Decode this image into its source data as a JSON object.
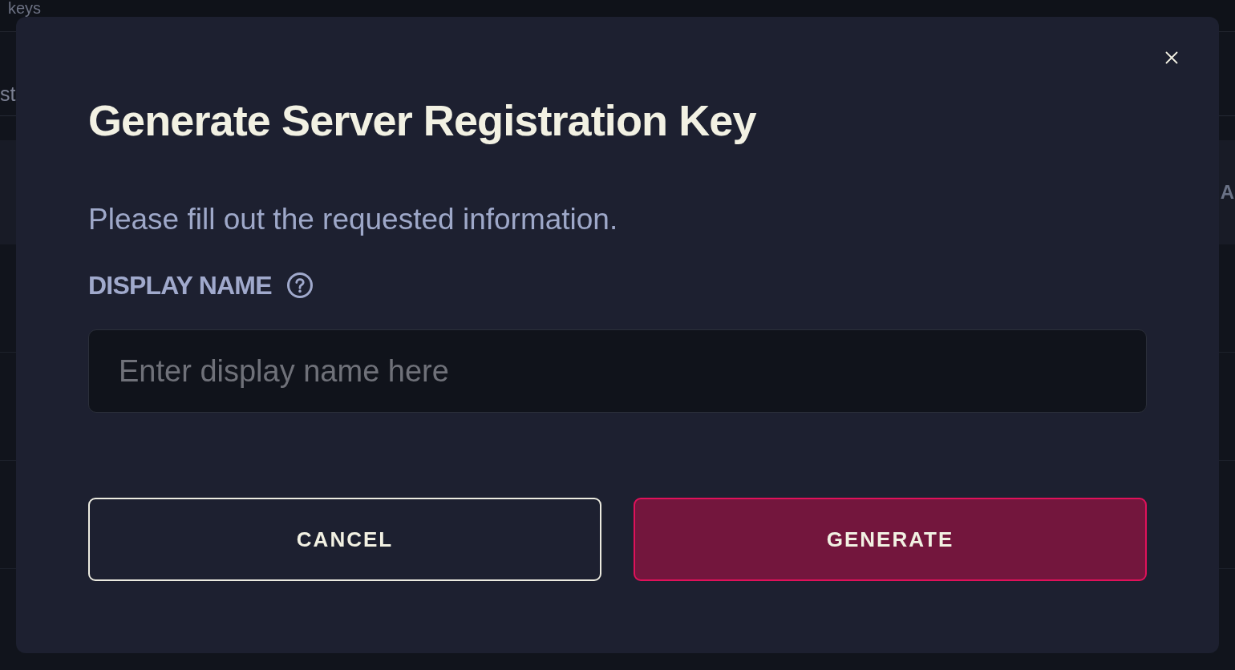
{
  "background_page": {
    "title_fragment": "keys",
    "left_fragment": "st",
    "right_fragment": "A"
  },
  "dialog": {
    "title": "Generate Server Registration Key",
    "description": "Please fill out the requested information.",
    "fields": [
      {
        "label": "DISPLAY NAME",
        "placeholder": "Enter display name here"
      }
    ],
    "buttons": [
      {
        "label": "CANCEL",
        "kind": "secondary"
      },
      {
        "label": "GENERATE",
        "kind": "primary"
      }
    ]
  }
}
